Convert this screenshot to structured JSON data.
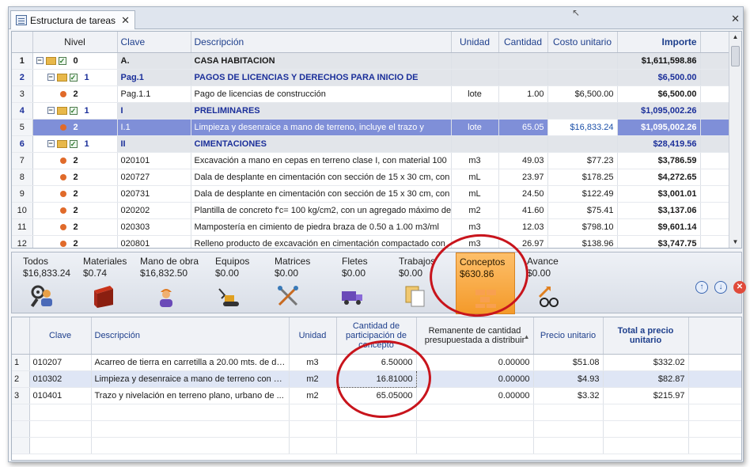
{
  "window": {
    "tab_title": "Estructura de tareas",
    "tab_close": "✕",
    "window_close": "✕"
  },
  "upper_grid": {
    "columns": [
      "Nivel",
      "Clave",
      "Descripción",
      "Unidad",
      "Cantidad",
      "Costo unitario",
      "Importe"
    ],
    "rows": [
      {
        "n": "1",
        "nivel": "0",
        "clave": "A.",
        "desc": "CASA HABITACION",
        "unidad": "",
        "cantidad": "",
        "costo": "",
        "importe": "$1,611,598.86"
      },
      {
        "n": "2",
        "nivel": "1",
        "clave": "Pag.1",
        "desc": "PAGOS DE LICENCIAS Y DERECHOS PARA INICIO DE",
        "unidad": "",
        "cantidad": "",
        "costo": "",
        "importe": "$6,500.00"
      },
      {
        "n": "3",
        "nivel": "2",
        "clave": "Pag.1.1",
        "desc": "Pago de licencias de construcción",
        "unidad": "lote",
        "cantidad": "1.00",
        "costo": "$6,500.00",
        "importe": "$6,500.00"
      },
      {
        "n": "4",
        "nivel": "1",
        "clave": "I",
        "desc": "PRELIMINARES",
        "unidad": "",
        "cantidad": "",
        "costo": "",
        "importe": "$1,095,002.26"
      },
      {
        "n": "5",
        "nivel": "2",
        "clave": "I.1",
        "desc": "Limpieza y desenraice a mano de terreno, incluye el trazo y",
        "unidad": "lote",
        "cantidad": "65.05",
        "costo": "$16,833.24",
        "importe": "$1,095,002.26"
      },
      {
        "n": "6",
        "nivel": "1",
        "clave": "II",
        "desc": "CIMENTACIONES",
        "unidad": "",
        "cantidad": "",
        "costo": "",
        "importe": "$28,419.56"
      },
      {
        "n": "7",
        "nivel": "2",
        "clave": "020101",
        "desc": "Excavación a mano en cepas en terreno clase I, con material 100",
        "unidad": "m3",
        "cantidad": "49.03",
        "costo": "$77.23",
        "importe": "$3,786.59"
      },
      {
        "n": "8",
        "nivel": "2",
        "clave": "020727",
        "desc": "Dala de desplante en cimentación con sección de 15 x 30 cm, con",
        "unidad": "mL",
        "cantidad": "23.97",
        "costo": "$178.25",
        "importe": "$4,272.65"
      },
      {
        "n": "9",
        "nivel": "2",
        "clave": "020731",
        "desc": "Dala de desplante en cimentación con sección de 15 x 30 cm, con",
        "unidad": "mL",
        "cantidad": "24.50",
        "costo": "$122.49",
        "importe": "$3,001.01"
      },
      {
        "n": "10",
        "nivel": "2",
        "clave": "020202",
        "desc": "Plantilla de concreto f'c= 100 kg/cm2, con un agregado máximo de",
        "unidad": "m2",
        "cantidad": "41.60",
        "costo": "$75.41",
        "importe": "$3,137.06"
      },
      {
        "n": "11",
        "nivel": "2",
        "clave": "020303",
        "desc": "Mampostería en cimiento de piedra braza de 0.50 a 1.00 m3/ml",
        "unidad": "m3",
        "cantidad": "12.03",
        "costo": "$798.10",
        "importe": "$9,601.14"
      },
      {
        "n": "12",
        "nivel": "2",
        "clave": "020801",
        "desc": "Relleno producto de excavación en cimentación compactado con",
        "unidad": "m3",
        "cantidad": "26.97",
        "costo": "$138.96",
        "importe": "$3,747.75"
      }
    ]
  },
  "toolbar": {
    "items": [
      {
        "label": "Todos",
        "value": "$16,833.24",
        "icon": "worker-gear-icon"
      },
      {
        "label": "Materiales",
        "value": "$0.74",
        "icon": "steel-beam-icon"
      },
      {
        "label": "Mano de obra",
        "value": "$16,832.50",
        "icon": "worker-icon"
      },
      {
        "label": "Equipos",
        "value": "$0.00",
        "icon": "excavator-icon"
      },
      {
        "label": "Matrices",
        "value": "$0.00",
        "icon": "tools-icon"
      },
      {
        "label": "Fletes",
        "value": "$0.00",
        "icon": "truck-icon"
      },
      {
        "label": "Trabajos",
        "value": "$0.00",
        "icon": "documents-icon"
      },
      {
        "label": "Conceptos",
        "value": "$630.86",
        "icon": "bricks-icon"
      },
      {
        "label": "Avance",
        "value": "$0.00",
        "icon": "progress-glasses-icon"
      }
    ],
    "up_label": "↑",
    "down_label": "↓",
    "delete_label": "✕"
  },
  "lower_grid": {
    "columns": [
      "Clave",
      "Descripción",
      "Unidad",
      "Cantidad de participación de concepto",
      "Remanente de cantidad presupuestada a distribuir",
      "Precio unitario",
      "Total a precio unitario"
    ],
    "rows": [
      {
        "n": "1",
        "clave": "010207",
        "desc": "Acarreo de tierra en carretilla a 20.00 mts. de di...",
        "unidad": "m3",
        "cantidad": "6.50000",
        "remanente": "0.00000",
        "precio": "$51.08",
        "total": "$332.02"
      },
      {
        "n": "2",
        "clave": "010302",
        "desc": "Limpieza y desenraice a mano de terreno con m...",
        "unidad": "m2",
        "cantidad": "16.81000",
        "remanente": "0.00000",
        "precio": "$4.93",
        "total": "$82.87"
      },
      {
        "n": "3",
        "clave": "010401",
        "desc": "Trazo y nivelación en terreno plano, urbano de ...",
        "unidad": "m2",
        "cantidad": "65.05000",
        "remanente": "0.00000",
        "precio": "$3.32",
        "total": "$215.97"
      }
    ]
  },
  "colors": {
    "selected_row": "#7f8fd8",
    "active_toolbar": "#f49a2a",
    "annotation": "#c8141c",
    "header_text": "#1e3f8c"
  }
}
